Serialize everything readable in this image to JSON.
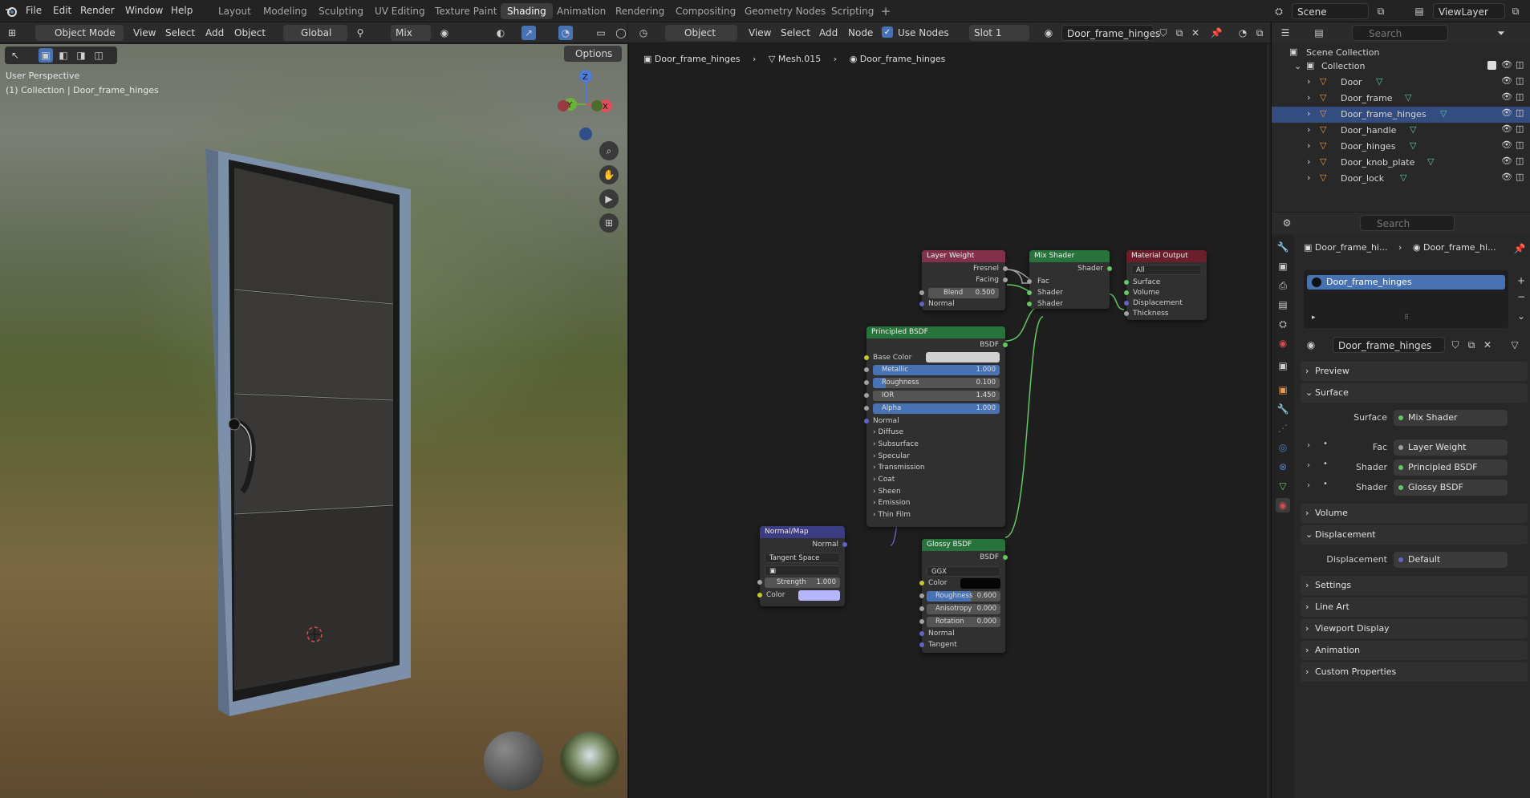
{
  "menu": {
    "file": "File",
    "edit": "Edit",
    "render": "Render",
    "window": "Window",
    "help": "Help"
  },
  "workspaces": [
    "Layout",
    "Modeling",
    "Sculpting",
    "UV Editing",
    "Texture Paint",
    "Shading",
    "Animation",
    "Rendering",
    "Compositing",
    "Geometry Nodes",
    "Scripting"
  ],
  "active_workspace": "Shading",
  "scene": {
    "name": "Scene",
    "view_layer": "ViewLayer",
    "search_placeholder": "Search"
  },
  "viewport": {
    "mode": "Object Mode",
    "view": "View",
    "select": "Select",
    "add": "Add",
    "object": "Object",
    "orientation": "Global",
    "pivot": "Mix",
    "options": "Options",
    "perspective": "User Perspective",
    "collection_info": "(1) Collection | Door_frame_hinges"
  },
  "node_header": {
    "type": "Object",
    "view": "View",
    "select": "Select",
    "add": "Add",
    "node": "Node",
    "use_nodes": "Use Nodes",
    "slot": "Slot 1",
    "material": "Door_frame_hinges"
  },
  "breadcrumb": {
    "object": "Door_frame_hinges",
    "mesh": "Mesh.015",
    "material": "Door_frame_hinges"
  },
  "nodes": {
    "layer_weight": {
      "title": "Layer Weight",
      "out1": "Fresnel",
      "out2": "Facing",
      "blend_label": "Blend",
      "blend": "0.500",
      "normal": "Normal"
    },
    "mix_shader": {
      "title": "Mix Shader",
      "out": "Shader",
      "fac": "Fac",
      "in1": "Shader",
      "in2": "Shader"
    },
    "material_output": {
      "title": "Material Output",
      "target": "All",
      "surface": "Surface",
      "volume": "Volume",
      "displacement": "Displacement",
      "thickness": "Thickness"
    },
    "principled": {
      "title": "Principled BSDF",
      "out": "BSDF",
      "base_color": "Base Color",
      "metallic_label": "Metallic",
      "metallic": "1.000",
      "roughness_label": "Roughness",
      "roughness": "0.100",
      "ior_label": "IOR",
      "ior": "1.450",
      "alpha_label": "Alpha",
      "alpha": "1.000",
      "normal": "Normal",
      "panels": [
        "Diffuse",
        "Subsurface",
        "Specular",
        "Transmission",
        "Coat",
        "Sheen",
        "Emission",
        "Thin Film"
      ]
    },
    "normal_map": {
      "title": "Normal/Map",
      "out": "Normal",
      "space": "Tangent Space",
      "strength_label": "Strength",
      "strength": "1.000",
      "color": "Color"
    },
    "glossy": {
      "title": "Glossy BSDF",
      "out": "BSDF",
      "distribution": "GGX",
      "color": "Color",
      "roughness_label": "Roughness",
      "roughness": "0.600",
      "anisotropy_label": "Anisotropy",
      "anisotropy": "0.000",
      "rotation_label": "Rotation",
      "rotation": "0.000",
      "normal": "Normal",
      "tangent": "Tangent"
    }
  },
  "outliner": {
    "scene_collection": "Scene Collection",
    "collection": "Collection",
    "items": [
      "Door",
      "Door_frame",
      "Door_frame_hinges",
      "Door_handle",
      "Door_hinges",
      "Door_knob_plate",
      "Door_lock"
    ]
  },
  "properties": {
    "search_placeholder": "Search",
    "crumb_object": "Door_frame_hi...",
    "crumb_material": "Door_frame_hi...",
    "slot_name": "Door_frame_hinges",
    "material_name": "Door_frame_hinges",
    "panels": {
      "preview": "Preview",
      "surface": "Surface",
      "volume": "Volume",
      "displacement": "Displacement",
      "settings": "Settings",
      "line_art": "Line Art",
      "viewport_display": "Viewport Display",
      "animation": "Animation",
      "custom_properties": "Custom Properties"
    },
    "surface_label": "Surface",
    "surface_value": "Mix Shader",
    "fac_label": "Fac",
    "fac_value": "Layer Weight",
    "shader1_label": "Shader",
    "shader1_value": "Principled BSDF",
    "shader2_label": "Shader",
    "shader2_value": "Glossy BSDF",
    "displacement_label": "Displacement",
    "displacement_value": "Default"
  },
  "colors": {
    "accent": "#4772b3",
    "shader_node": "#28723c",
    "input_node": "#83314a",
    "output_node": "#6a1f2b",
    "vector_node": "#3c3c83"
  }
}
